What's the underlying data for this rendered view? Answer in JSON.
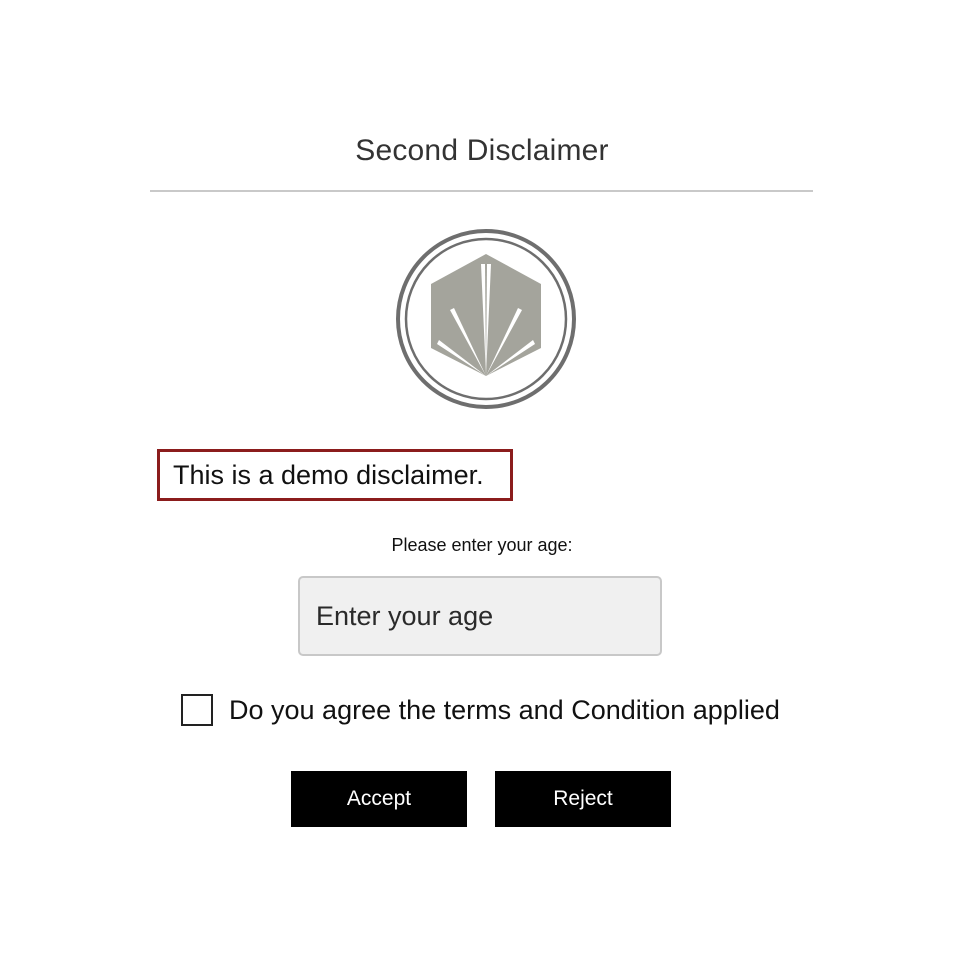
{
  "dialog": {
    "title": "Second Disclaimer",
    "disclaimer_text": "This is a demo disclaimer.",
    "age_label": "Please enter your age:",
    "age_input": {
      "value": "",
      "placeholder": "Enter your age"
    },
    "terms": {
      "label": "Do you agree the terms and Condition applied",
      "checked": false
    },
    "buttons": {
      "accept_label": "Accept",
      "reject_label": "Reject"
    }
  },
  "logo": {
    "icon": "hexagon-leaf-logo-icon"
  },
  "colors": {
    "background": "#ffffff",
    "divider": "#c9c9c9",
    "logo_gray": "#a4a49c",
    "logo_ring": "#6e6e6e",
    "disclaimer_border": "#8b1c1c",
    "input_background": "#f0f0f0",
    "button_background": "#000000",
    "button_text": "#ffffff"
  }
}
